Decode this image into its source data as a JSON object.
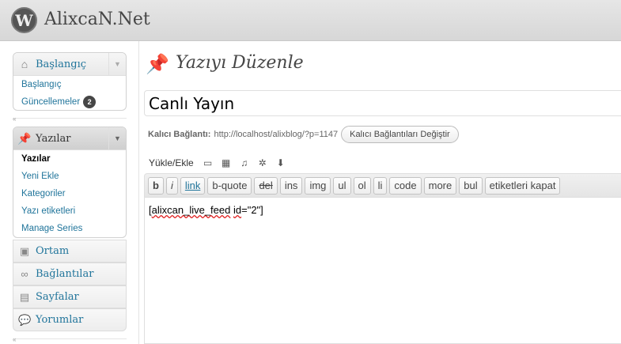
{
  "site": {
    "title": "AlixcaN.Net",
    "logo_icon": "wordpress-logo-icon"
  },
  "sidebar": {
    "dashboard": {
      "label": "Başlangıç",
      "icon": "home-icon",
      "items": [
        {
          "label": "Başlangıç"
        },
        {
          "label": "Güncellemeler",
          "badge": "2"
        }
      ]
    },
    "posts": {
      "label": "Yazılar",
      "icon": "pushpin-icon",
      "items": [
        {
          "label": "Yazılar",
          "current": true
        },
        {
          "label": "Yeni Ekle"
        },
        {
          "label": "Kategoriler"
        },
        {
          "label": "Yazı etiketleri"
        },
        {
          "label": "Manage Series"
        }
      ]
    },
    "collapsed": [
      {
        "label": "Ortam",
        "icon": "media-icon"
      },
      {
        "label": "Bağlantılar",
        "icon": "link-icon"
      },
      {
        "label": "Sayfalar",
        "icon": "pages-icon"
      },
      {
        "label": "Yorumlar",
        "icon": "comment-icon"
      }
    ]
  },
  "main": {
    "page_title": "Yazıyı Düzenle",
    "post_title": "Canlı Yayın",
    "permalink": {
      "label": "Kalıcı Bağlantı:",
      "url": "http://localhost/alixblog/?p=1147",
      "change_button": "Kalıcı Bağlantıları Değiştir"
    },
    "upload": {
      "label": "Yükle/Ekle",
      "icons": [
        "image-upload-icon",
        "video-upload-icon",
        "audio-upload-icon",
        "media-upload-icon",
        "download-icon"
      ]
    },
    "quicktags": [
      "b",
      "i",
      "link",
      "b-quote",
      "del",
      "ins",
      "img",
      "ul",
      "ol",
      "li",
      "code",
      "more",
      "bul",
      "etiketleri kapat"
    ],
    "editor_content": {
      "open": "[",
      "tag": "alixcan_live_feed",
      "space": " ",
      "attr": "id",
      "value": "=\"2\"]"
    }
  }
}
